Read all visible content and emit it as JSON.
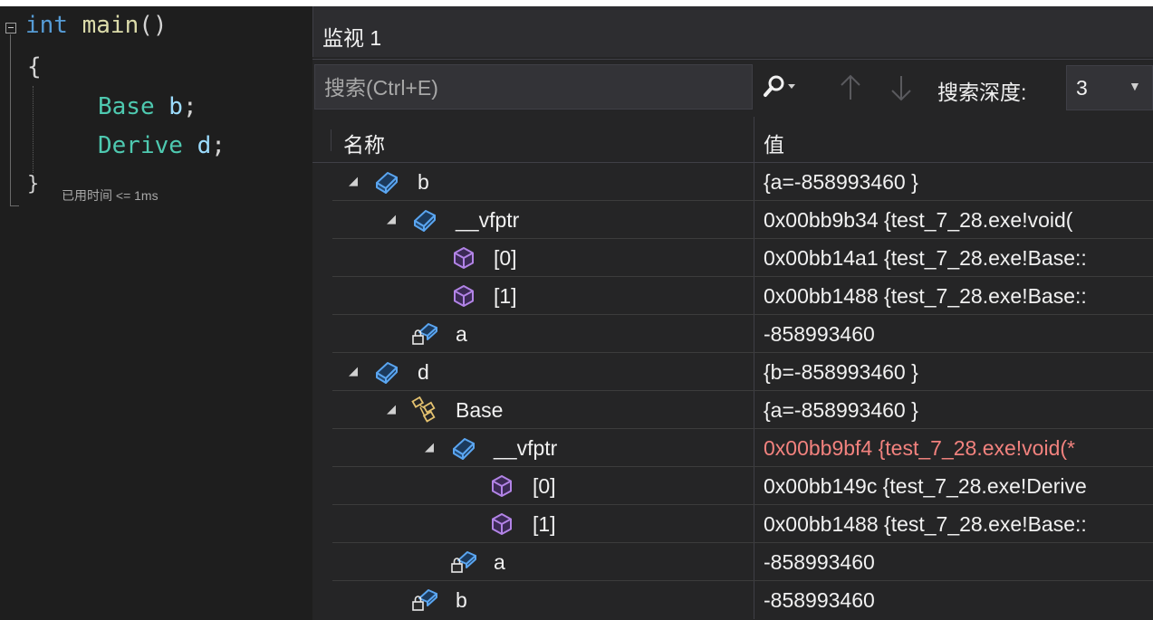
{
  "editor": {
    "line1": {
      "keyword": "int",
      "name": "main",
      "rest": "()"
    },
    "line2": "{",
    "line3": {
      "type": "Base",
      "var": "b",
      "semi": ";"
    },
    "line4": {
      "type": "Derive",
      "var": "d",
      "semi": ";"
    },
    "line5": "}",
    "elapsed": "已用时间 <= 1ms"
  },
  "watch": {
    "title": "监视 1",
    "search_placeholder": "搜索(Ctrl+E)",
    "depth_label": "搜索深度:",
    "depth_value": "3",
    "columns": {
      "name": "名称",
      "value": "值"
    },
    "rows": [
      {
        "name": "b",
        "value": "{a=-858993460 }",
        "icon": "object-icon"
      },
      {
        "name": "__vfptr",
        "value": "0x00bb9b34 {test_7_28.exe!void(",
        "icon": "object-icon"
      },
      {
        "name": "[0]",
        "value": "0x00bb14a1 {test_7_28.exe!Base::",
        "icon": "method-icon"
      },
      {
        "name": "[1]",
        "value": "0x00bb1488 {test_7_28.exe!Base::",
        "icon": "method-icon"
      },
      {
        "name": "a",
        "value": "-858993460",
        "icon": "private-field-icon"
      },
      {
        "name": "d",
        "value": "{b=-858993460 }",
        "icon": "object-icon"
      },
      {
        "name": "Base",
        "value": "{a=-858993460 }",
        "icon": "base-class-icon"
      },
      {
        "name": "__vfptr",
        "value": "0x00bb9bf4 {test_7_28.exe!void(*",
        "icon": "object-icon"
      },
      {
        "name": "[0]",
        "value": "0x00bb149c {test_7_28.exe!Derive",
        "icon": "method-icon"
      },
      {
        "name": "[1]",
        "value": "0x00bb1488 {test_7_28.exe!Base::",
        "icon": "method-icon"
      },
      {
        "name": "a",
        "value": "-858993460",
        "icon": "private-field-icon"
      },
      {
        "name": "b",
        "value": "-858993460",
        "icon": "private-field-icon"
      }
    ],
    "changed_value_color": "#f2827e"
  }
}
